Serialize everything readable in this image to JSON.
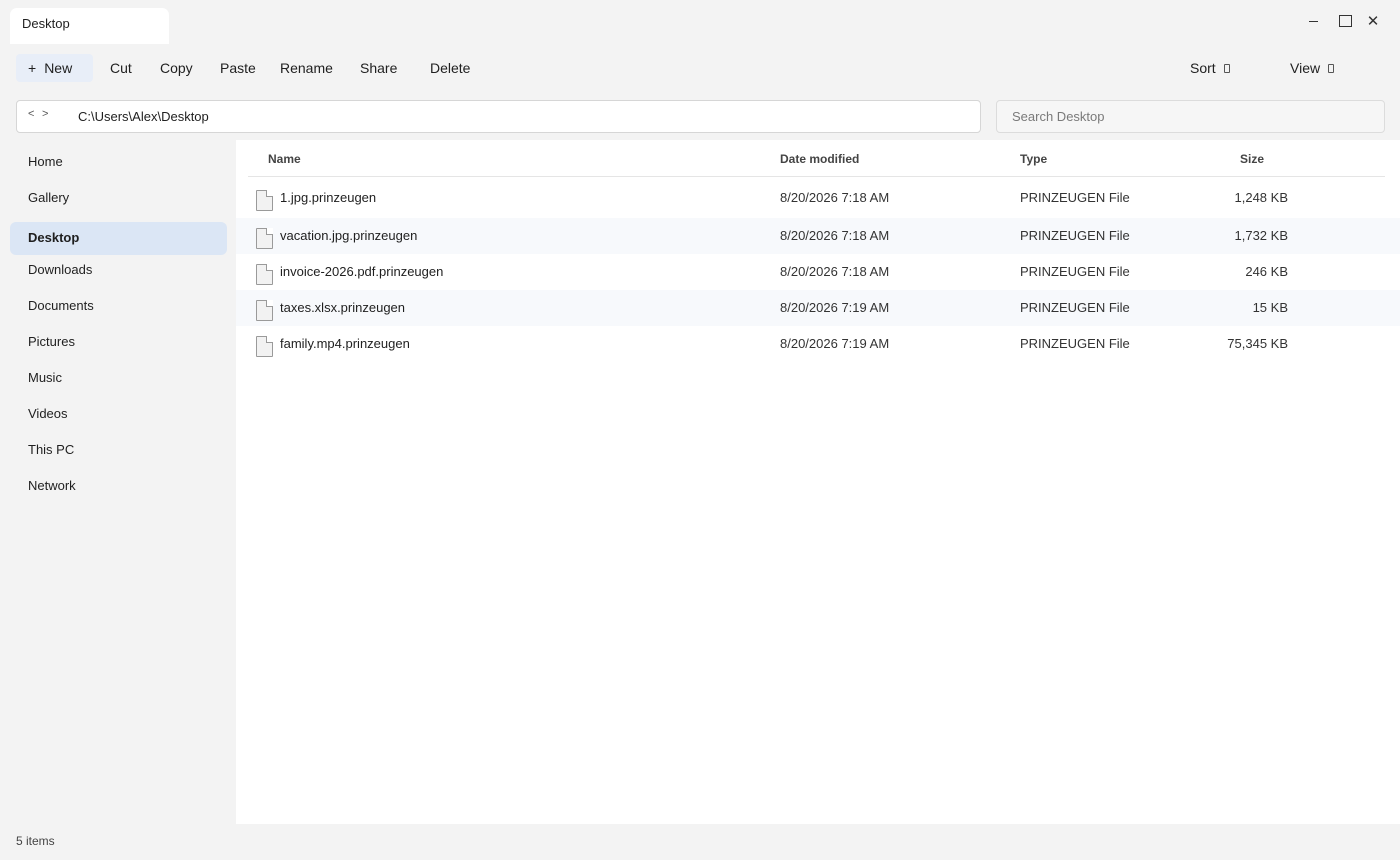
{
  "window": {
    "tab_title": "Desktop",
    "controls": {
      "minimize": "–",
      "close": "✕"
    }
  },
  "toolbar": {
    "new_label": "New",
    "new_icon": "+",
    "cut_label": "Cut",
    "copy_label": "Copy",
    "paste_label": "Paste",
    "rename_label": "Rename",
    "share_label": "Share",
    "delete_label": "Delete",
    "sort_label": "Sort",
    "view_label": "View"
  },
  "address": {
    "back": "<",
    "forward": ">",
    "path": "C:\\Users\\Alex\\Desktop"
  },
  "search": {
    "placeholder": "Search Desktop",
    "value": ""
  },
  "sidebar": {
    "items": [
      {
        "label": "Home"
      },
      {
        "label": "Gallery"
      },
      {
        "label": "Desktop",
        "selected": true
      },
      {
        "label": "Downloads"
      },
      {
        "label": "Documents"
      },
      {
        "label": "Pictures"
      },
      {
        "label": "Music"
      },
      {
        "label": "Videos"
      },
      {
        "label": "This PC"
      },
      {
        "label": "Network"
      }
    ]
  },
  "file_list": {
    "columns": [
      "Name",
      "Date modified",
      "Type",
      "Size"
    ],
    "rows": [
      {
        "name": "1.jpg.prinzeugen",
        "date": "8/20/2026 7:18 AM",
        "type": "PRINZEUGEN File",
        "size": "1,248 KB"
      },
      {
        "name": "vacation.jpg.prinzeugen",
        "date": "8/20/2026 7:18 AM",
        "type": "PRINZEUGEN File",
        "size": "1,732 KB"
      },
      {
        "name": "invoice-2026.pdf.prinzeugen",
        "date": "8/20/2026 7:18 AM",
        "type": "PRINZEUGEN File",
        "size": "246 KB"
      },
      {
        "name": "taxes.xlsx.prinzeugen",
        "date": "8/20/2026 7:19 AM",
        "type": "PRINZEUGEN File",
        "size": "15 KB"
      },
      {
        "name": "family.mp4.prinzeugen",
        "date": "8/20/2026 7:19 AM",
        "type": "PRINZEUGEN File",
        "size": "75,345 KB"
      }
    ]
  },
  "status": {
    "item_count": "5 items"
  },
  "colors": {
    "accent_selected": "#dbe6f5",
    "new_button_bg": "#e8eef8",
    "chrome_bg": "#f3f3f3",
    "content_bg": "#ffffff"
  }
}
